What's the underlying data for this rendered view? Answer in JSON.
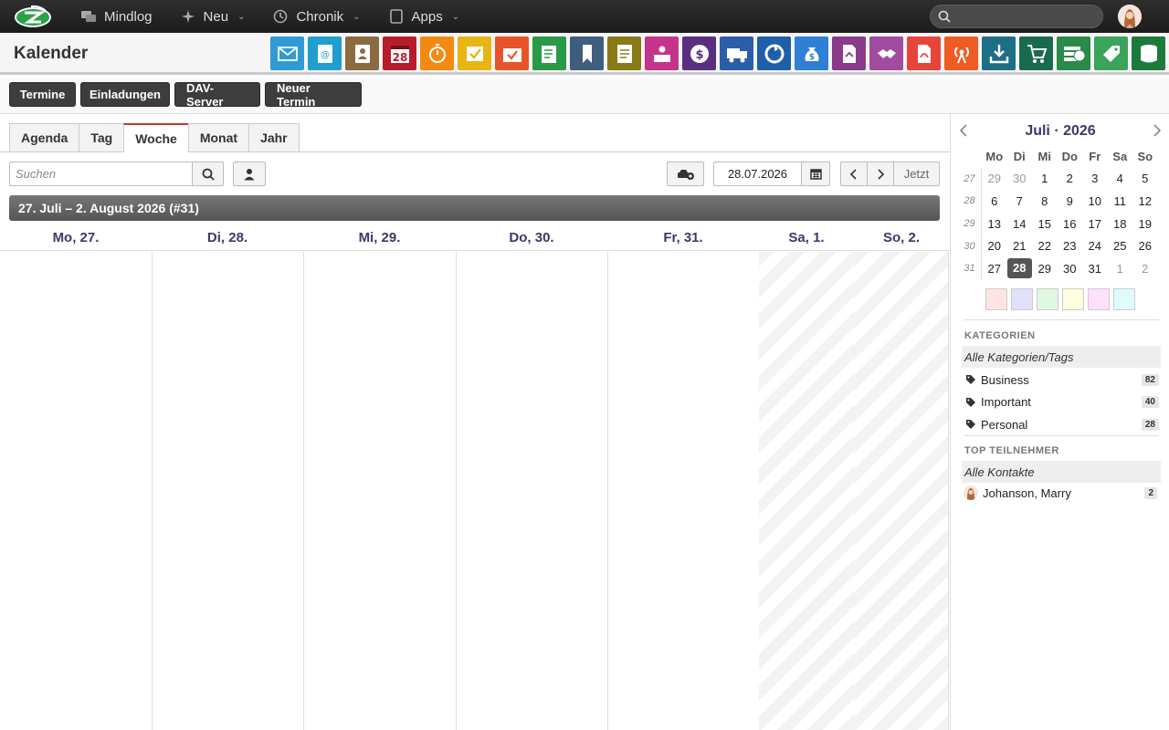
{
  "topbar": {
    "logo": "cerb-logo",
    "nav": [
      {
        "label": "Mindlog",
        "icon": "chat-icon",
        "chevron": false
      },
      {
        "label": "Neu",
        "icon": "sparkle-icon",
        "chevron": true
      },
      {
        "label": "Chronik",
        "icon": "history-icon",
        "chevron": true
      },
      {
        "label": "Apps",
        "icon": "tablet-icon",
        "chevron": true
      }
    ],
    "search_placeholder": ""
  },
  "page": {
    "title": "Kalender"
  },
  "app_icons": [
    {
      "name": "mail-icon",
      "color": "#2f9bd6"
    },
    {
      "name": "address-book-icon",
      "color": "#1e9fcf"
    },
    {
      "name": "contacts-icon",
      "color": "#8b6b3f"
    },
    {
      "name": "calendar-icon",
      "color": "#b71c2b",
      "text": "28"
    },
    {
      "name": "timer-icon",
      "color": "#f28a12"
    },
    {
      "name": "tasks-icon",
      "color": "#e8b515"
    },
    {
      "name": "folder-check-icon",
      "color": "#e8542a"
    },
    {
      "name": "notes-icon",
      "color": "#2a9a48"
    },
    {
      "name": "bookmark-icon",
      "color": "#3f5e7e"
    },
    {
      "name": "document-icon",
      "color": "#8a7a17"
    },
    {
      "name": "reception-icon",
      "color": "#c5338a"
    },
    {
      "name": "dollar-icon",
      "color": "#5a2f80"
    },
    {
      "name": "truck-icon",
      "color": "#2a5ea8"
    },
    {
      "name": "recycle-icon",
      "color": "#1e5fa8"
    },
    {
      "name": "money-bag-icon",
      "color": "#2f7fd6"
    },
    {
      "name": "contract-icon",
      "color": "#8a3a8a"
    },
    {
      "name": "handshake-icon",
      "color": "#a14ba1"
    },
    {
      "name": "pdf-icon",
      "color": "#e8453a"
    },
    {
      "name": "broadcast-icon",
      "color": "#ef5b22"
    },
    {
      "name": "download-icon",
      "color": "#1e6f86"
    },
    {
      "name": "cart-icon",
      "color": "#1a6a50"
    },
    {
      "name": "cash-icon",
      "color": "#2a8a4a"
    },
    {
      "name": "price-tag-icon",
      "color": "#3aa55a"
    },
    {
      "name": "database-icon",
      "color": "#1c7a3a"
    }
  ],
  "toolbar": {
    "buttons": [
      "Termine",
      "Einladungen",
      "DAV-Server",
      "Neuer Termin"
    ]
  },
  "view_tabs": {
    "tabs": [
      "Agenda",
      "Tag",
      "Woche",
      "Monat",
      "Jahr"
    ],
    "active": "Woche"
  },
  "filter": {
    "search_placeholder": "Suchen",
    "date": "28.07.2026",
    "now_label": "Jetzt"
  },
  "week": {
    "title": "27. Juli – 2. August 2026 (#31)",
    "days": [
      "Mo, 27.",
      "Di, 28.",
      "Mi, 29.",
      "Do, 30.",
      "Fr, 31.",
      "Sa, 1.",
      "So, 2."
    ]
  },
  "mini_calendar": {
    "title": "Juli · 2026",
    "dow": [
      "Mo",
      "Di",
      "Mi",
      "Do",
      "Fr",
      "Sa",
      "So"
    ],
    "weeks": [
      {
        "num": "27",
        "days": [
          "29",
          "30",
          "1",
          "2",
          "3",
          "4",
          "5"
        ]
      },
      {
        "num": "28",
        "days": [
          "6",
          "7",
          "8",
          "9",
          "10",
          "11",
          "12"
        ]
      },
      {
        "num": "29",
        "days": [
          "13",
          "14",
          "15",
          "16",
          "17",
          "18",
          "19"
        ]
      },
      {
        "num": "30",
        "days": [
          "20",
          "21",
          "22",
          "23",
          "24",
          "25",
          "26"
        ]
      },
      {
        "num": "31",
        "days": [
          "27",
          "28",
          "29",
          "30",
          "31",
          "1",
          "2"
        ]
      }
    ],
    "today": "28",
    "swatch_colors": [
      "#fde3e3",
      "#e0e0fb",
      "#e0f7e0",
      "#fdfde0",
      "#fde0fb",
      "#e0fbfb"
    ]
  },
  "categories": {
    "title": "KATEGORIEN",
    "all_label": "Alle Kategorien/Tags",
    "items": [
      {
        "label": "Business",
        "count": "82"
      },
      {
        "label": "Important",
        "count": "40"
      },
      {
        "label": "Personal",
        "count": "28"
      }
    ]
  },
  "participants": {
    "title": "TOP TEILNEHMER",
    "all_label": "Alle Kontakte",
    "items": [
      {
        "label": "Johanson, Marry",
        "count": "2"
      }
    ]
  }
}
